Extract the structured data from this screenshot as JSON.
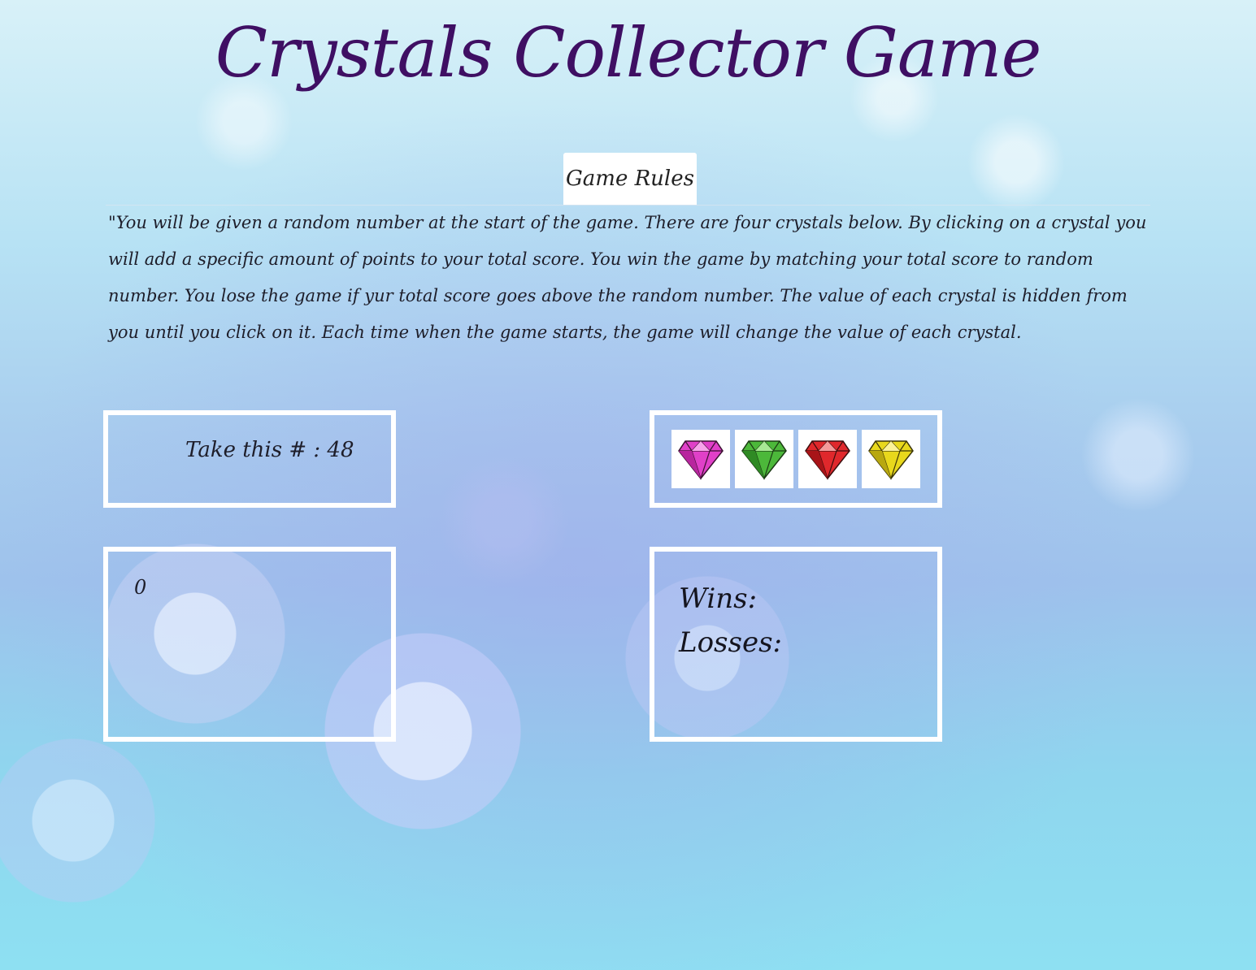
{
  "header": {
    "title": "Crystals Collector Game"
  },
  "rules": {
    "tab_label": "Game Rules",
    "text": "\"You will be given a random number at the start of the game. There are four crystals below. By clicking on a crystal you will add a specific amount of points to your total score. You win the game by matching your total score to random number. You lose the game if yur total score goes above the random number. The value of each crystal is hidden from you until you click on it. Each time when the game starts, the game will change the value of each crystal."
  },
  "target": {
    "label": "Take this # : 48"
  },
  "crystals": [
    {
      "icon": "pink-crystal-icon",
      "color": "#e040c8"
    },
    {
      "icon": "green-crystal-icon",
      "color": "#4cb83a"
    },
    {
      "icon": "red-crystal-icon",
      "color": "#e0282c"
    },
    {
      "icon": "yellow-crystal-icon",
      "color": "#e8d81c"
    }
  ],
  "score": {
    "value": "0"
  },
  "stats": {
    "wins_label": "Wins:",
    "losses_label": "Losses:"
  },
  "colors": {
    "title": "#3f0f63",
    "box_border": "#ffffff"
  }
}
